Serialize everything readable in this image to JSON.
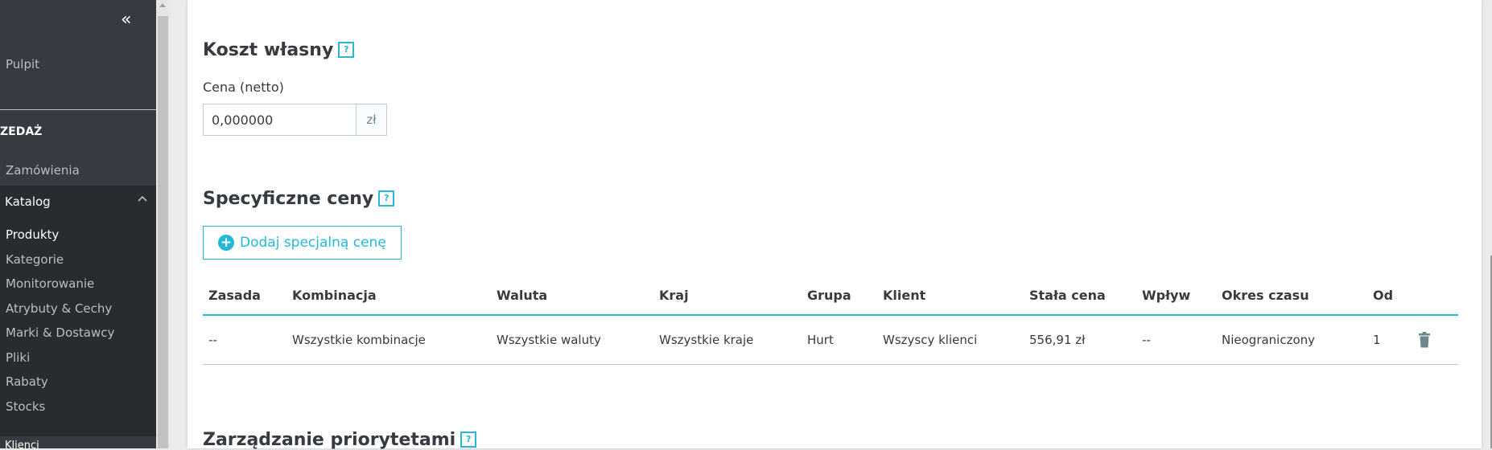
{
  "sidebar": {
    "collapse_icon": "«",
    "dashboard": "Pulpit",
    "section_sales": "ZEDAŻ",
    "orders": "Zamówienia",
    "catalog": "Katalog",
    "catalog_items": [
      {
        "label": "Produkty",
        "active": true
      },
      {
        "label": "Kategorie",
        "active": false
      },
      {
        "label": "Monitorowanie",
        "active": false
      },
      {
        "label": "Atrybuty & Cechy",
        "active": false
      },
      {
        "label": "Marki & Dostawcy",
        "active": false
      },
      {
        "label": "Pliki",
        "active": false
      },
      {
        "label": "Rabaty",
        "active": false
      },
      {
        "label": "Stocks",
        "active": false
      }
    ],
    "next_section_partial": "Klienci"
  },
  "cost": {
    "title": "Koszt własny",
    "help_icon": "?",
    "price_label": "Cena (netto)",
    "price_value": "0,000000",
    "currency": "zł"
  },
  "specific_prices": {
    "title": "Specyficzne ceny",
    "help_icon": "?",
    "add_button": "Dodaj specjalną cenę",
    "columns": [
      "Zasada",
      "Kombinacja",
      "Waluta",
      "Kraj",
      "Grupa",
      "Klient",
      "Stała cena",
      "Wpływ",
      "Okres czasu",
      "Od",
      ""
    ],
    "rows": [
      [
        "--",
        "Wszystkie kombinacje",
        "Wszystkie waluty",
        "Wszystkie kraje",
        "Hurt",
        "Wszyscy klienci",
        "556,91 zł",
        "--",
        "Nieograniczony",
        "1"
      ]
    ]
  },
  "priority": {
    "title": "Zarządzanie priorytetami",
    "help_icon": "?"
  },
  "colors": {
    "accent": "#25b9d7",
    "sidebar_bg": "#363a41",
    "sidebar_sub_bg": "#282b30"
  }
}
